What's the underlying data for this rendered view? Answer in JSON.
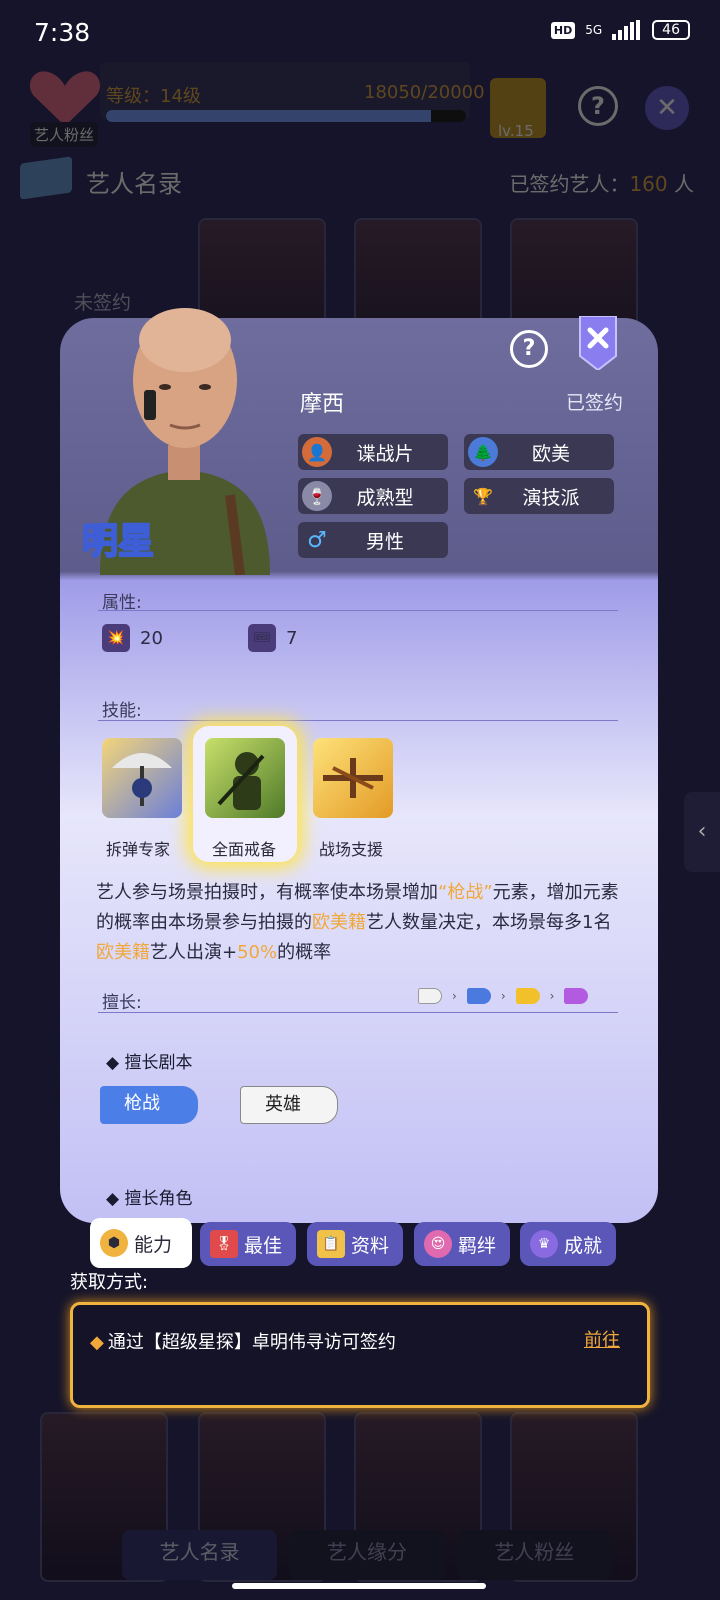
{
  "status_bar": {
    "time": "7:38",
    "hd": "HD",
    "network": "5G",
    "battery": "46"
  },
  "background": {
    "fan_label": "艺人粉丝",
    "level_label": "等级：14级",
    "level_value": "18050/20000",
    "level_progress": 0.9025,
    "clapper_level": "lv.15",
    "directory_title": "艺人名录",
    "signed_prefix": "已签约艺人：",
    "signed_count": "160",
    "signed_unit": "人",
    "unsigned_label": "未签约",
    "bottom_tabs": [
      "艺人名录",
      "艺人缘分",
      "艺人粉丝"
    ]
  },
  "card": {
    "name": "摩西",
    "signed_status": "已签约",
    "star_badge": "明星",
    "tags": [
      {
        "label": "谍战片",
        "icon": "silhouette-icon"
      },
      {
        "label": "欧美",
        "icon": "tree-icon"
      },
      {
        "label": "成熟型",
        "icon": "wine-icon"
      },
      {
        "label": "演技派",
        "icon": "trophy-icon"
      },
      {
        "label": "男性",
        "icon": "male-icon"
      }
    ],
    "attributes_title": "属性:",
    "attributes": [
      {
        "value": "20",
        "icon": "explosion-icon"
      },
      {
        "value": "7",
        "icon": "ticket-icon"
      }
    ],
    "skills_title": "技能:",
    "skills": [
      {
        "name": "拆弹专家",
        "icon": "umbrella-soldier-icon"
      },
      {
        "name": "全面戒备",
        "icon": "soldier-icon"
      },
      {
        "name": "战场支援",
        "icon": "warplane-icon"
      }
    ],
    "description": {
      "p1": "艺人参与场景拍摄时，有概率使本场景增加",
      "h1": "“枪战”",
      "p2": "元素，增加元素的概率由本场景参与拍摄的",
      "h2": "欧美籍",
      "p3": "艺人数量决定，本场景每多1名",
      "h3": "欧美籍",
      "p4": "艺人出演+",
      "h4": "50%",
      "p5": "的概率"
    },
    "specialty_title": "擅长:",
    "good_scripts_label": "擅长剧本",
    "scripts": [
      "枪战",
      "英雄"
    ],
    "good_roles_label": "擅长角色"
  },
  "card_tabs": [
    "能力",
    "最佳",
    "资料",
    "羁绊",
    "成就"
  ],
  "acquire": {
    "title": "获取方式:",
    "text": "通过【超级星探】卓明伟寻访可签约",
    "link": "前往"
  }
}
